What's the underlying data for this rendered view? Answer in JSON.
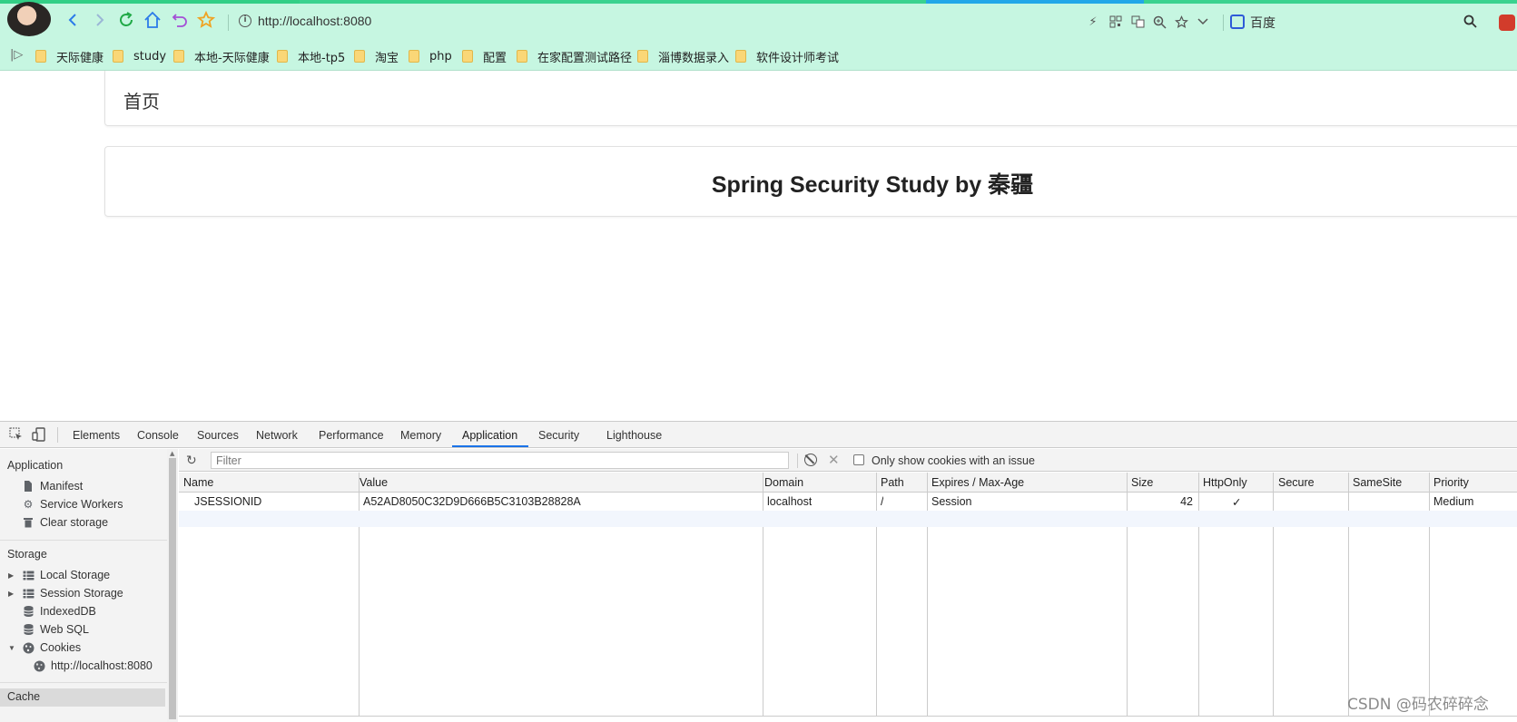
{
  "browser": {
    "url": "http://localhost:8080",
    "search_engine": "百度",
    "bookmarks": [
      "天际健康",
      "study",
      "本地-天际健康",
      "本地-tp5",
      "淘宝",
      "php",
      "配置",
      "在家配置测试路径",
      "淄博数据录入",
      "软件设计师考试"
    ]
  },
  "page": {
    "home_label": "首页",
    "title": "Spring Security Study by 秦疆"
  },
  "devtools": {
    "tabs": [
      "Elements",
      "Console",
      "Sources",
      "Network",
      "Performance",
      "Memory",
      "Application",
      "Security",
      "Lighthouse"
    ],
    "active_tab": "Application",
    "sidebar": {
      "application_header": "Application",
      "application_items": [
        "Manifest",
        "Service Workers",
        "Clear storage"
      ],
      "storage_header": "Storage",
      "storage_items": [
        "Local Storage",
        "Session Storage",
        "IndexedDB",
        "Web SQL",
        "Cookies"
      ],
      "cookie_origin": "http://localhost:8080",
      "cache_header": "Cache"
    },
    "filter_placeholder": "Filter",
    "only_issue_label": "Only show cookies with an issue",
    "columns": [
      "Name",
      "Value",
      "Domain",
      "Path",
      "Expires / Max-Age",
      "Size",
      "HttpOnly",
      "Secure",
      "SameSite",
      "Priority"
    ],
    "cookie": {
      "name": "JSESSIONID",
      "value": "A52AD8050C32D9D666B5C3103B28828A",
      "domain": "localhost",
      "path": "/",
      "expires": "Session",
      "size": "42",
      "httponly": "✓",
      "secure": "",
      "samesite": "",
      "priority": "Medium"
    }
  },
  "watermark": "CSDN @码农碎碎念"
}
